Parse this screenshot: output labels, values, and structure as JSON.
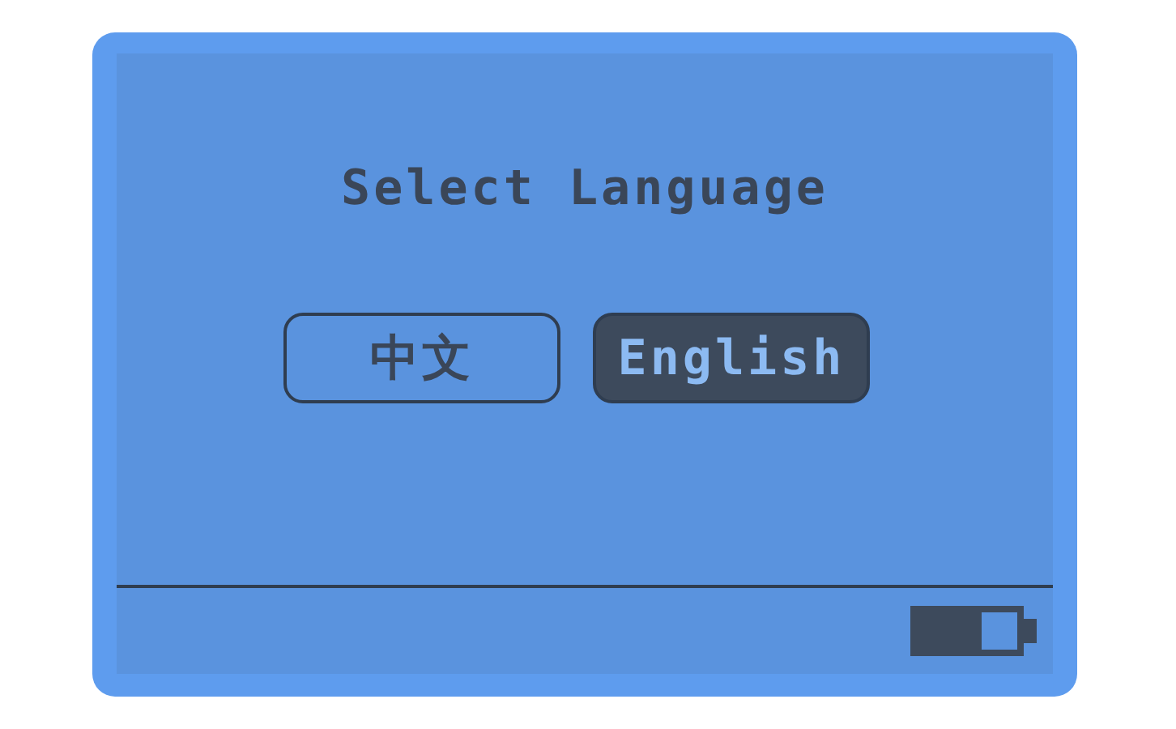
{
  "title": "Select Language",
  "options": [
    {
      "label": "中文",
      "selected": false
    },
    {
      "label": "English",
      "selected": true
    }
  ]
}
